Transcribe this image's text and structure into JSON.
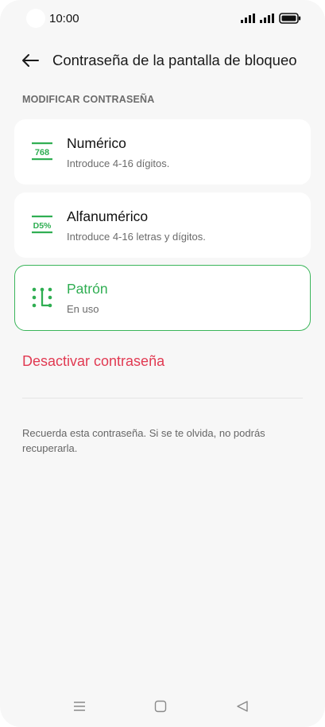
{
  "status_bar": {
    "time": "10:00",
    "icons": [
      "signal-icon",
      "signal-icon",
      "battery-icon"
    ]
  },
  "header": {
    "back_icon": "arrow-left-icon",
    "title": "Contraseña de la pantalla de bloqueo"
  },
  "section": {
    "title": "MODIFICAR CONTRASEÑA"
  },
  "options": [
    {
      "icon": "numeric-icon",
      "icon_text": "768",
      "label": "Numérico",
      "description": "Introduce 4-16 dígitos.",
      "selected": false
    },
    {
      "icon": "alphanumeric-icon",
      "icon_text": "D5%",
      "label": "Alfanumérico",
      "description": "Introduce 4-16 letras y dígitos.",
      "selected": false
    },
    {
      "icon": "pattern-icon",
      "label": "Patrón",
      "description": "En uso",
      "selected": true
    }
  ],
  "deactivate": {
    "label": "Desactivar contraseña"
  },
  "note": "Recuerda esta contraseña. Si se te olvida, no podrás recuperarla.",
  "navbar": {
    "icons": [
      "menu-icon",
      "home-icon",
      "back-triangle-icon"
    ]
  },
  "colors": {
    "accent": "#2fae52",
    "danger": "#e13a52",
    "background": "#f7f7f7",
    "card": "#ffffff"
  }
}
